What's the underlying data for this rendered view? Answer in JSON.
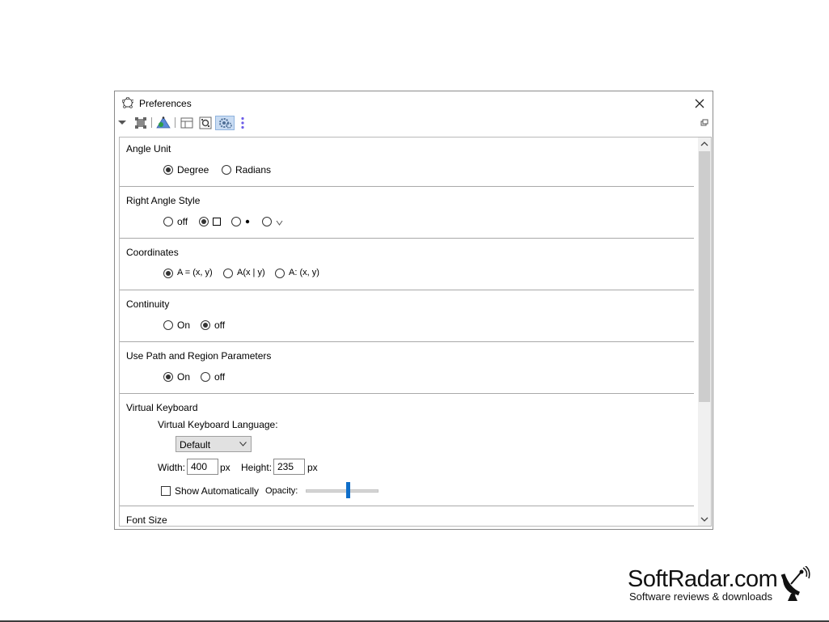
{
  "window": {
    "title": "Preferences"
  },
  "sections": {
    "angle_unit": {
      "title": "Angle Unit",
      "options": [
        "Degree",
        "Radians"
      ],
      "selected": "Degree"
    },
    "right_angle_style": {
      "title": "Right Angle Style",
      "options": [
        "off",
        "square",
        "dot",
        "L"
      ],
      "first_label": "off",
      "selected": "square"
    },
    "coordinates": {
      "title": "Coordinates",
      "options": [
        "A = (x, y)",
        "A(x | y)",
        "A: (x, y)"
      ],
      "selected": "A = (x, y)"
    },
    "continuity": {
      "title": "Continuity",
      "options": [
        "On",
        "off"
      ],
      "selected": "off"
    },
    "path_region": {
      "title": "Use Path and Region Parameters",
      "options": [
        "On",
        "off"
      ],
      "selected": "On"
    },
    "virtual_keyboard": {
      "title": "Virtual Keyboard",
      "language_label": "Virtual Keyboard Language:",
      "language_value": "Default",
      "width_label": "Width:",
      "width_value": "400",
      "width_unit": "px",
      "height_label": "Height:",
      "height_value": "235",
      "height_unit": "px",
      "show_auto_label": "Show Automatically",
      "show_auto_checked": false,
      "opacity_label": "Opacity:",
      "opacity_level": 0.6
    },
    "font_size": {
      "title": "Font Size"
    }
  },
  "toolbar": {
    "icons": [
      "dropdown-arrow-icon",
      "defaults-icon",
      "graphics-icon",
      "layout-icon",
      "algebra-settings-icon",
      "advanced-settings-icon",
      "more-icon",
      "window-restore-icon"
    ],
    "active": "advanced-settings-icon"
  },
  "watermark": {
    "title": "SoftRadar.com",
    "subtitle": "Software reviews & downloads"
  }
}
